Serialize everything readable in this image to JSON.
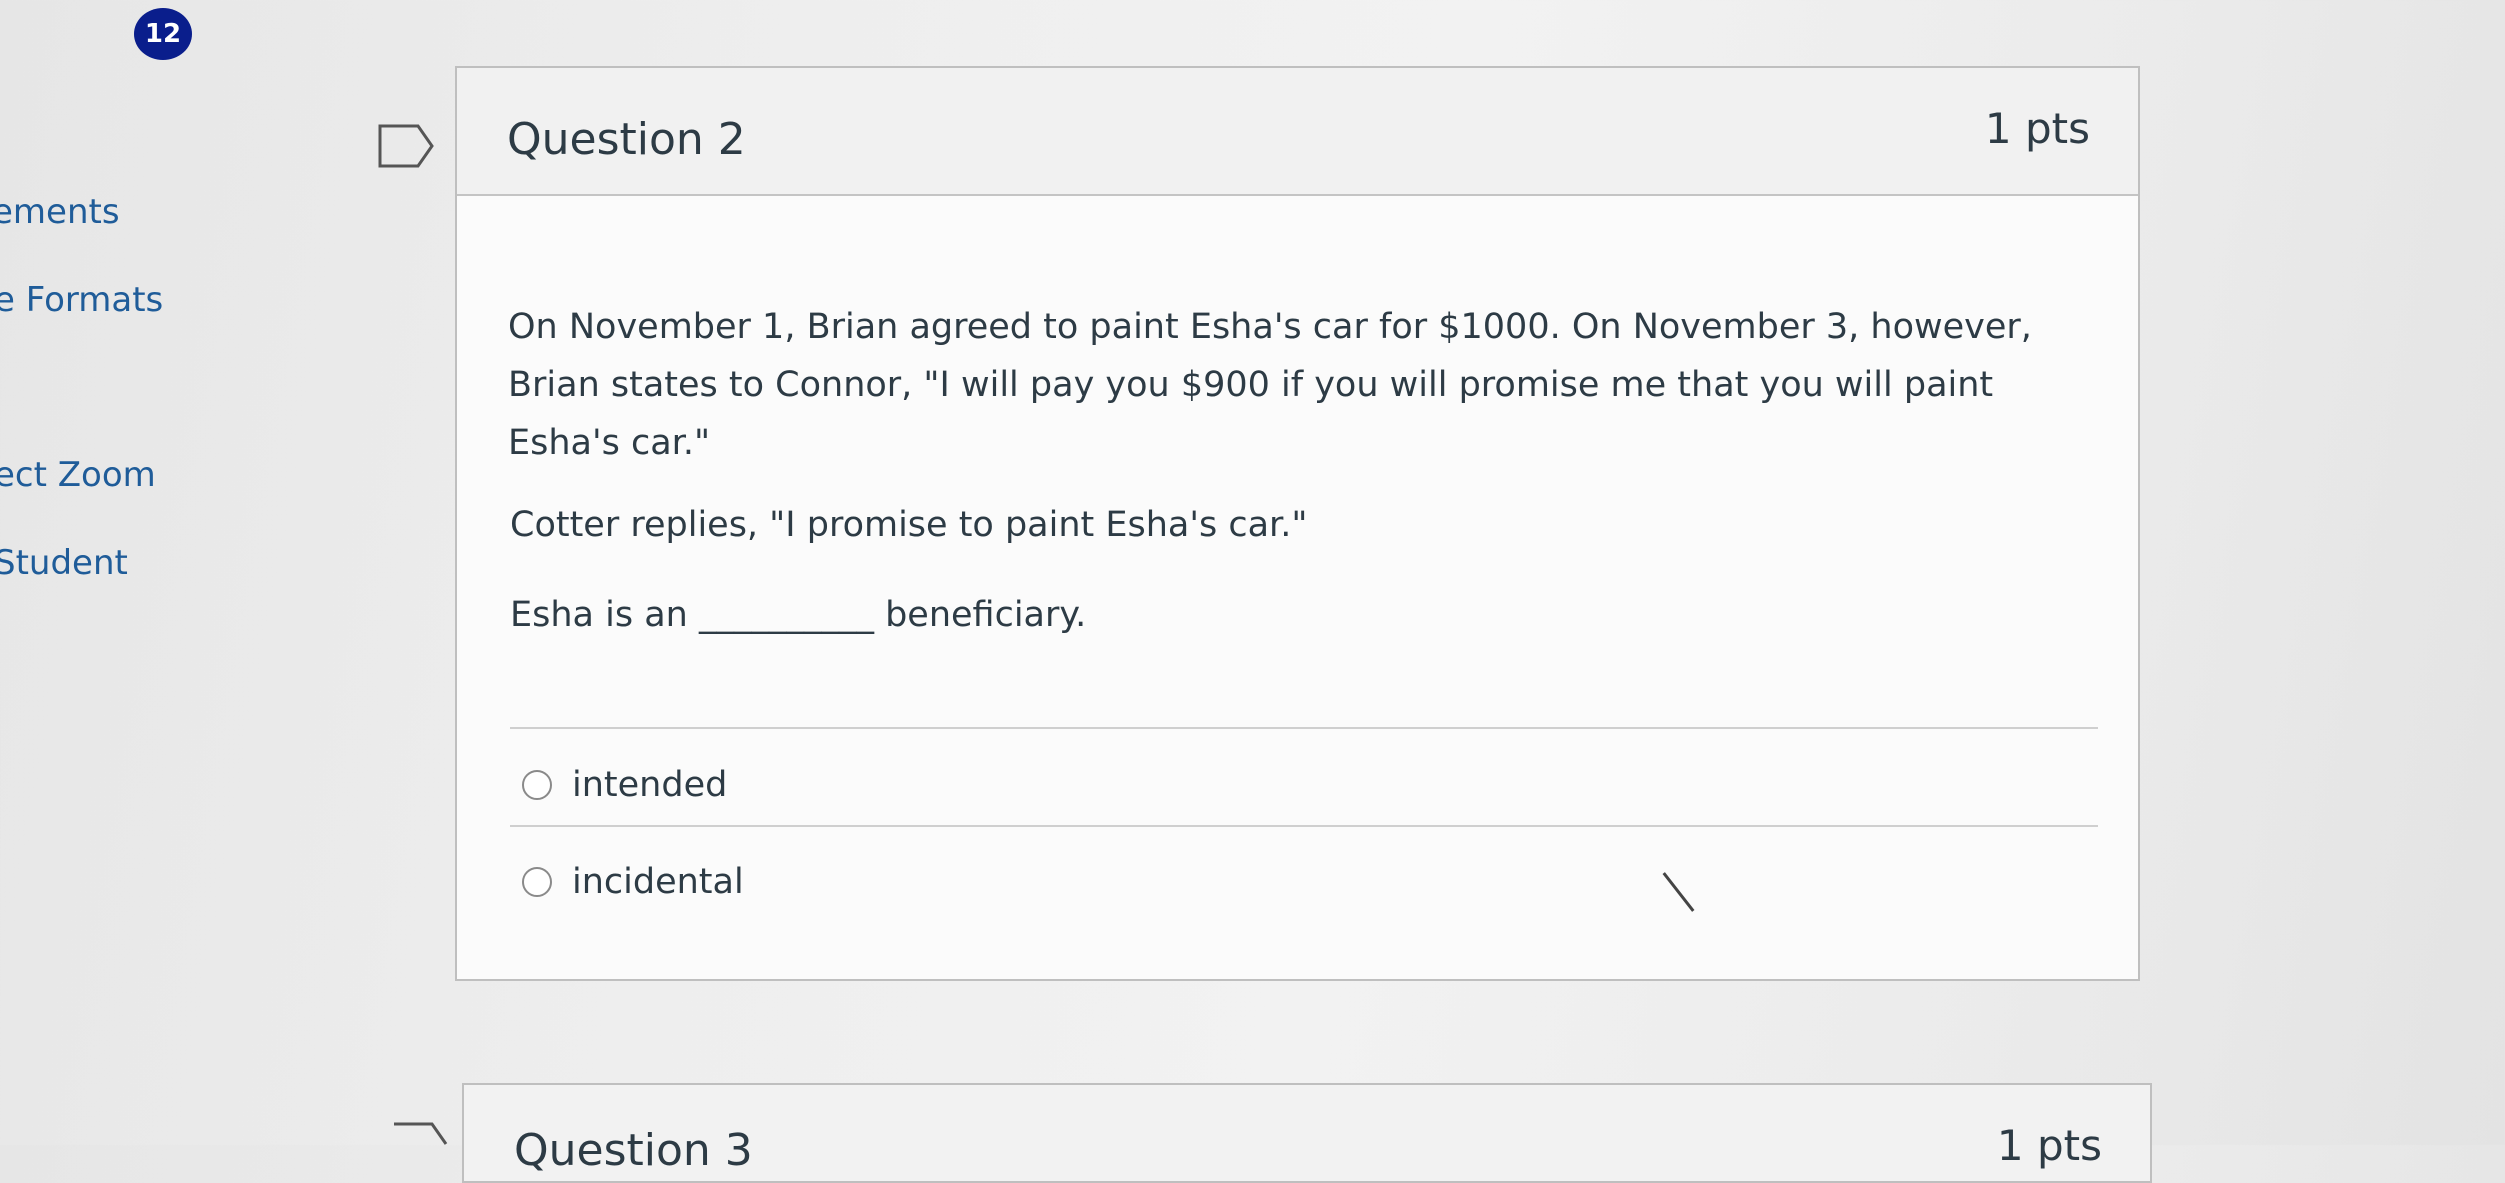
{
  "badge": {
    "count": "12"
  },
  "sidebar": {
    "items": [
      {
        "label": "ements"
      },
      {
        "label": "e Formats"
      },
      {
        "label": "ect Zoom"
      },
      {
        "label": "Student"
      }
    ]
  },
  "question": {
    "title": "Question 2",
    "points": "1 pts",
    "text_para1": "On November 1, Brian agreed to paint Esha's car for $1000. On November 3, however, Brian states to Connor, \"I will pay you $900 if you will promise me that you will paint Esha's car.\"",
    "text_para2": "Cotter replies, \"I promise to paint Esha's car.\"",
    "text_para3": "Esha is an __________ beneficiary.",
    "options": [
      {
        "label": "intended"
      },
      {
        "label": "incidental"
      }
    ]
  },
  "next_question": {
    "title": "Question 3",
    "points": "1 pts"
  }
}
